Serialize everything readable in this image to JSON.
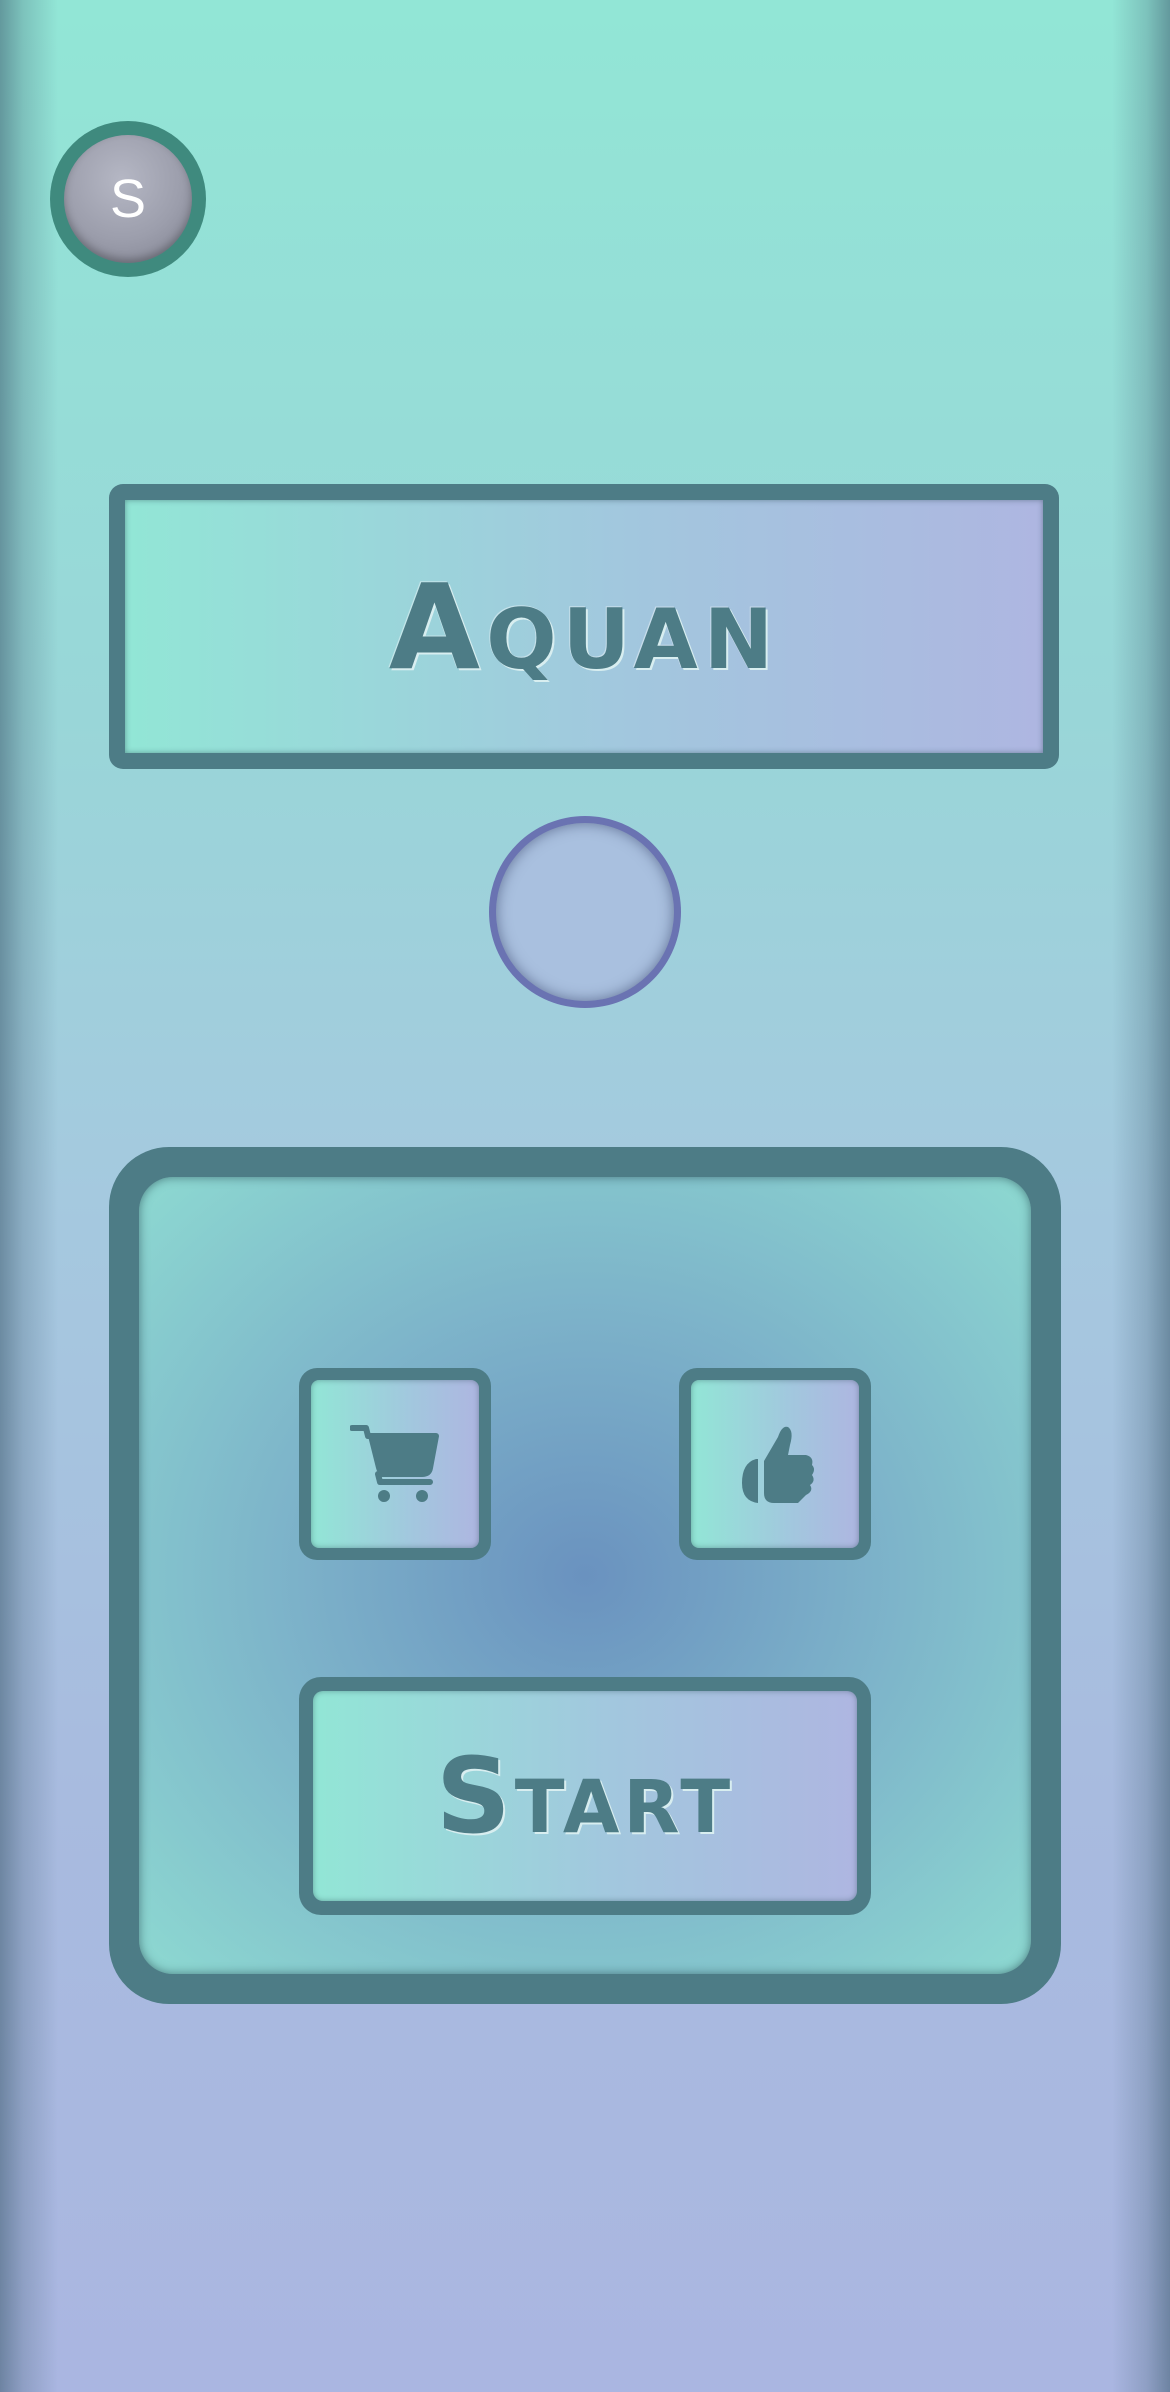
{
  "profile": {
    "avatar_initial": "S"
  },
  "title": {
    "text": "Aquan"
  },
  "menu": {
    "shop_icon": "shopping-cart-icon",
    "like_icon": "thumbs-up-icon",
    "start_label": "Start"
  },
  "colors": {
    "primary": "#4d7c86",
    "accent_teal": "#92e6d6",
    "accent_lavender": "#aeb6e1",
    "orb_ring": "#6a73b2",
    "avatar_ring": "#3f8a7e"
  }
}
